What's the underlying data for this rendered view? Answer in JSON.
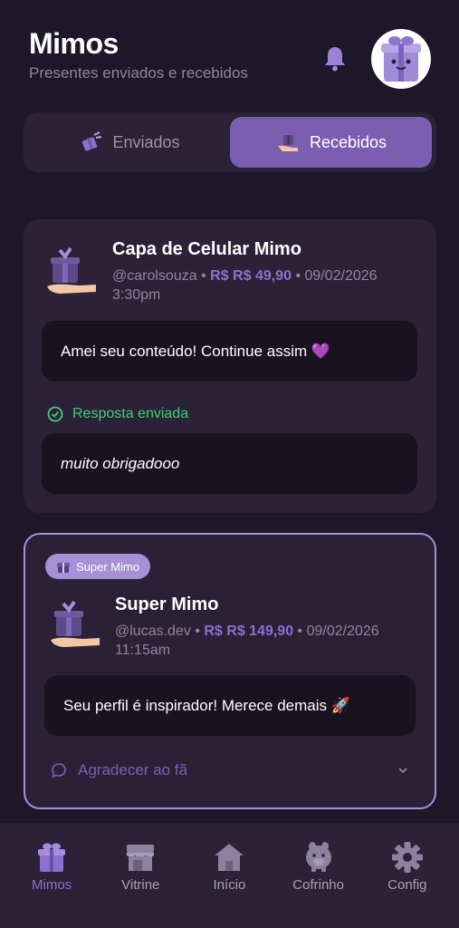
{
  "header": {
    "title": "Mimos",
    "subtitle": "Presentes enviados e recebidos"
  },
  "tabs": [
    {
      "label": "Enviados",
      "icon": "gift-send-icon",
      "active": false
    },
    {
      "label": "Recebidos",
      "icon": "gift-receive-icon",
      "active": true
    }
  ],
  "gifts": [
    {
      "title": "Capa de Celular Mimo",
      "user": "@carolsouza",
      "separator": "•",
      "price": "R$ R$ 49,90",
      "datetime": "09/02/2026 3:30pm",
      "message": "Amei seu conteúdo! Continue assim 💜",
      "reply_status": "Resposta enviada",
      "reply": "muito obrigadooo"
    },
    {
      "badge": "Super Mimo",
      "title": "Super Mimo",
      "user": "@lucas.dev",
      "separator": "•",
      "price": "R$ R$ 149,90",
      "datetime": "09/02/2026 11:15am",
      "message": "Seu perfil é inspirador! Merece demais 🚀",
      "thank_label": "Agradecer ao fã"
    }
  ],
  "bottom_nav": [
    {
      "label": "Mimos",
      "icon": "gift-icon",
      "active": true
    },
    {
      "label": "Vitrine",
      "icon": "storefront-icon",
      "active": false
    },
    {
      "label": "Início",
      "icon": "home-icon",
      "active": false
    },
    {
      "label": "Cofrinho",
      "icon": "piggy-bank-icon",
      "active": false
    },
    {
      "label": "Config",
      "icon": "gear-icon",
      "active": false
    }
  ],
  "colors": {
    "background": "#1e1629",
    "card": "#2b2238",
    "accent": "#7a5fb0",
    "price": "#8d6fd0",
    "success": "#3fcf74",
    "super_border": "#a990d6"
  }
}
